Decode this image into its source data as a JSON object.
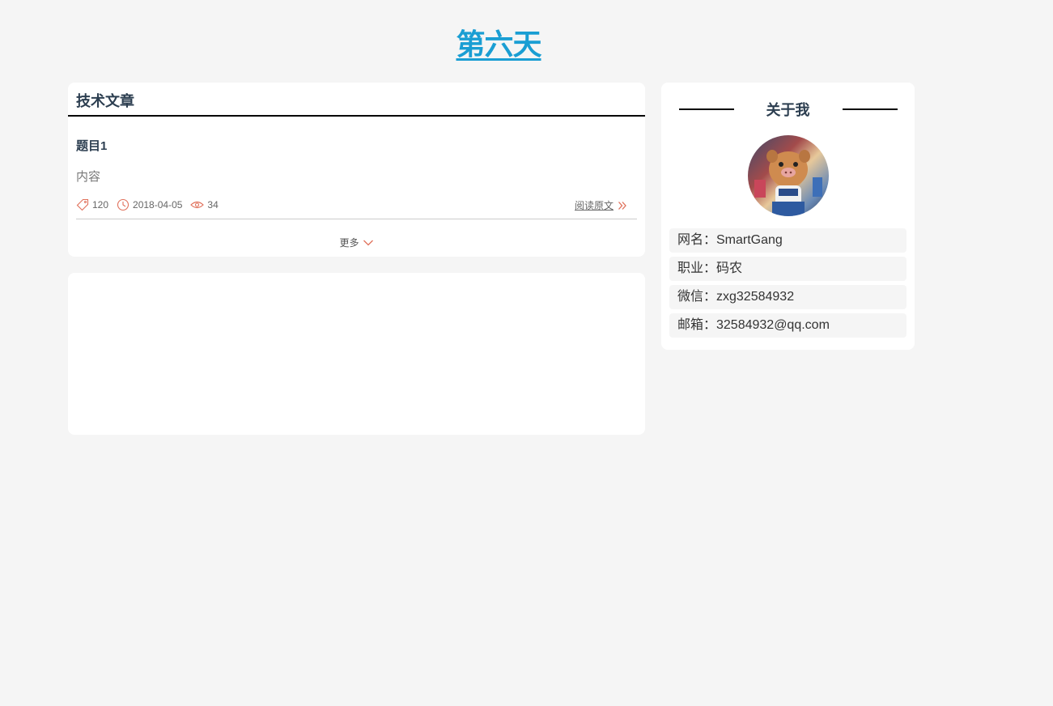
{
  "site": {
    "title": "第六天"
  },
  "articles": {
    "header": "技术文章",
    "items": [
      {
        "title": "题目1",
        "content": "内容",
        "tag_count": "120",
        "date": "2018-04-05",
        "views": "34",
        "read_more": "阅读原文"
      }
    ],
    "more_label": "更多"
  },
  "about": {
    "header": "关于我",
    "info": [
      {
        "text": "网名：SmartGang"
      },
      {
        "text": "职业：码农"
      },
      {
        "text": "微信：zxg32584932"
      },
      {
        "text": "邮箱：32584932@qq.com"
      }
    ]
  },
  "colors": {
    "title": "#1a9ed3",
    "icon_accent": "#e0705a",
    "background": "#f5f5f5"
  },
  "icons": {
    "tag": "tag-icon",
    "clock": "clock-icon",
    "eye": "eye-icon",
    "double_chevron": "double-chevron-right-icon",
    "chevron_down": "chevron-down-icon"
  }
}
